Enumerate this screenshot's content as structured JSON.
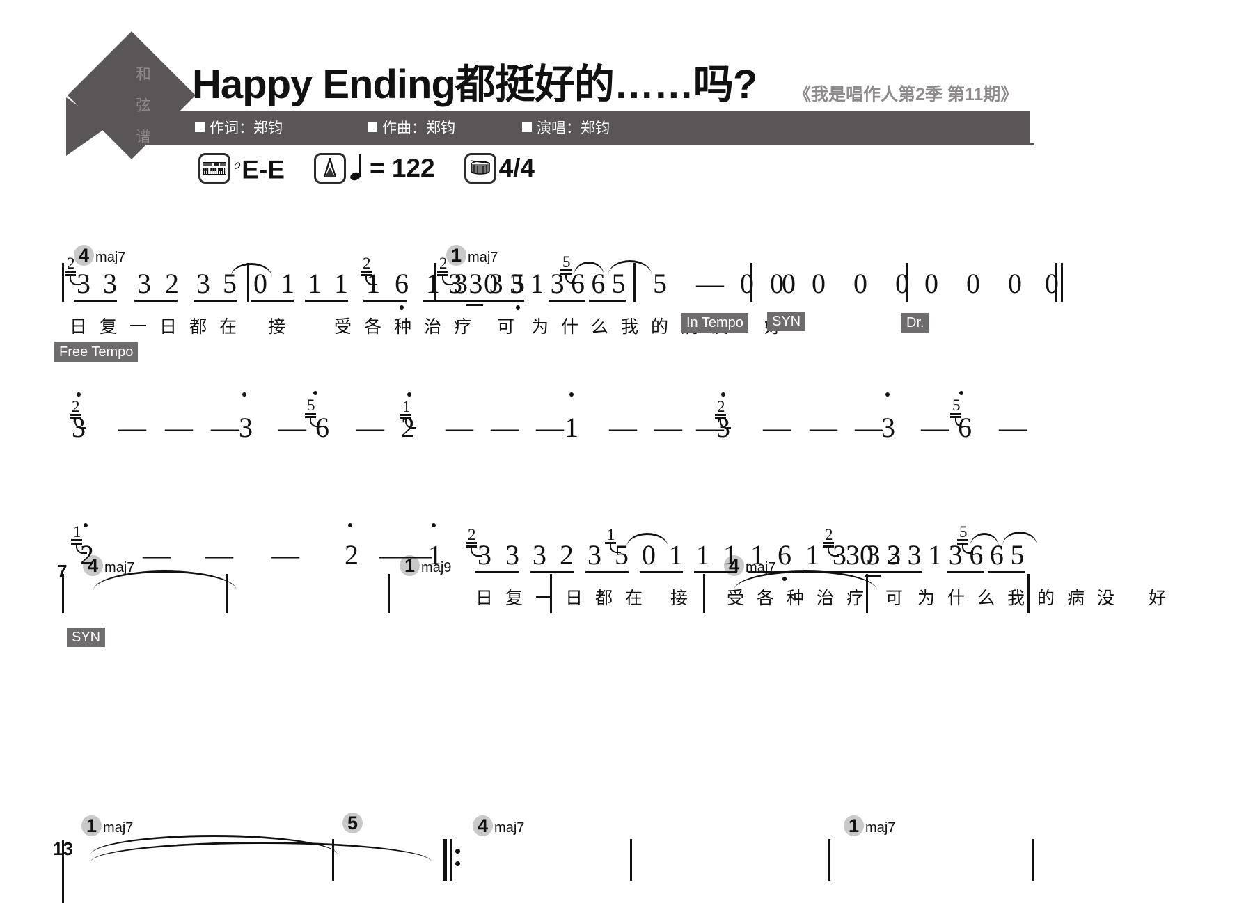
{
  "header": {
    "logo_chars": [
      "和",
      "弦",
      "谱"
    ],
    "title": "Happy Ending都挺好的……吗?",
    "show_name": "《我是唱作人第2季 第11期》",
    "credits": [
      {
        "role": "作词",
        "name": "郑钧",
        "text": "作词：郑钧"
      },
      {
        "role": "作曲",
        "name": "郑钧",
        "text": "作曲：郑钧"
      },
      {
        "role": "演唱",
        "name": "郑钧",
        "text": "演唱：郑钧"
      }
    ]
  },
  "meta": {
    "key_icon": "keyboard-icon",
    "key": "♭E-E",
    "key_flat": "♭",
    "key_text": "E-E",
    "tempo_icon": "metronome-icon",
    "tempo_equals": "= 122",
    "tempo_value": "122",
    "time_icon": "drum-icon",
    "time_signature": "4/4"
  },
  "score": {
    "lines": [
      {
        "measure_number": "",
        "chords": [
          {
            "root": "4",
            "quality": "maj7"
          },
          {
            "root": "1",
            "quality": "maj7"
          }
        ],
        "measures": [
          {
            "notes": [
              "3",
              "3",
              "3",
              "2",
              "3",
              "5",
              "0",
              "1"
            ]
          },
          {
            "notes": [
              "1",
              "1",
              "1",
              "6",
              "1",
              "3",
              "0",
              "5"
            ]
          },
          {
            "notes": [
              "3",
              "3",
              "3",
              "3",
              "1",
              "3",
              "6",
              "6",
              "5"
            ]
          },
          {
            "notes": [
              "5",
              "—",
              "0",
              "0"
            ]
          },
          {
            "notes": [
              "0",
              "0",
              "0",
              "0"
            ]
          },
          {
            "notes": [
              "0",
              "0",
              "0",
              "0"
            ]
          }
        ],
        "lyrics": "日复一日都在  接   受各种治疗  可  为什么我的病没   好",
        "badges": [
          "Free Tempo",
          "In Tempo",
          "SYN",
          "Dr."
        ]
      },
      {
        "measure_number": "7",
        "chords": [
          {
            "root": "4",
            "quality": "maj7"
          },
          {
            "root": "1",
            "quality": "maj9"
          },
          {
            "root": "4",
            "quality": "maj7"
          }
        ],
        "measures": [
          {
            "notes": [
              "3",
              "—",
              "—",
              "—"
            ]
          },
          {
            "notes": [
              "3",
              "—",
              "6",
              "—"
            ]
          },
          {
            "notes": [
              "2",
              "—",
              "—",
              "—"
            ]
          },
          {
            "notes": [
              "1",
              "—",
              "—",
              "—"
            ]
          },
          {
            "notes": [
              "3",
              "—",
              "—",
              "—"
            ]
          },
          {
            "notes": [
              "3",
              "—",
              "6",
              "—"
            ]
          }
        ],
        "lyrics": "",
        "badges": [
          "SYN"
        ]
      },
      {
        "measure_number": "13",
        "chords": [
          {
            "root": "1",
            "quality": "maj7"
          },
          {
            "root": "5",
            "quality": ""
          },
          {
            "root": "4",
            "quality": "maj7"
          },
          {
            "root": "1",
            "quality": "maj7"
          }
        ],
        "measures": [
          {
            "notes": [
              "2",
              "—",
              "—",
              "—"
            ]
          },
          {
            "notes": [
              "2",
              "—",
              "—",
              "1"
            ]
          },
          {
            "notes": [
              "3",
              "3",
              "3",
              "2",
              "3",
              "5",
              "0",
              "1"
            ]
          },
          {
            "notes": [
              "1",
              "1",
              "1",
              "6",
              "1",
              "3",
              "0",
              "2"
            ]
          },
          {
            "notes": [
              "3",
              "3",
              "3",
              "3",
              "1",
              "3",
              "6",
              "6",
              "5"
            ]
          }
        ],
        "lyrics": "日复一日都在  接   受各种治疗  可  为什么我的病没   好",
        "badges": []
      }
    ]
  },
  "colors": {
    "bar_gray": "#5a5657",
    "badge_gray": "#6f6c6d",
    "chord_chip": "#c9c9c9",
    "show_name_gray": "#8e8a8b",
    "ink": "#111111"
  }
}
